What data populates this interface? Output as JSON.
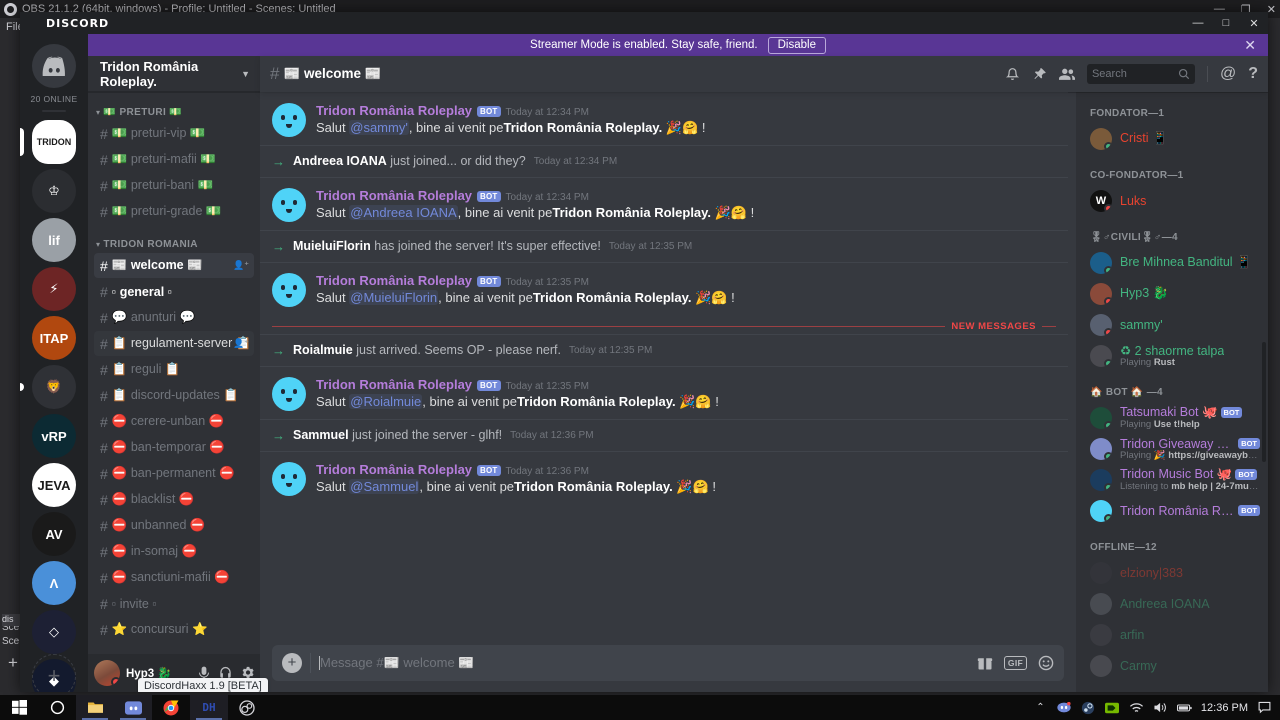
{
  "obs": {
    "title": "OBS 21.1.2 (64bit, windows) - Profile: Untitled - Scenes: Untitled",
    "menu": [
      "File"
    ],
    "side_labels": [
      "Sce",
      "Sce"
    ],
    "scene_item": "dis",
    "add_label": "+",
    "minimize": "—",
    "maximize": "❐",
    "close": "✕"
  },
  "discord": {
    "wordmark": "DISCORD",
    "window_buttons": {
      "minimize": "—",
      "maximize": "□",
      "close": "✕"
    },
    "streamer_banner": {
      "text": "Streamer Mode is enabled. Stay safe, friend.",
      "disable_label": "Disable",
      "close_icon": "✕",
      "color": "#593695"
    },
    "guild_rail": {
      "online_count": "20 ONLINE",
      "home_icon": "discord-home-icon",
      "add_label": "+",
      "servers": [
        {
          "name": "TRIDON RP",
          "short": "TRIDON",
          "selected": true,
          "color": "#ffffff"
        },
        {
          "name": "Crown Server",
          "short": "♔",
          "selected": false,
          "color": "#2b2d31"
        },
        {
          "name": "Elif Server",
          "short": "lif",
          "selected": false,
          "color": "#9aa0a6"
        },
        {
          "name": "Zeus Server",
          "short": "⚡",
          "selected": false,
          "color": "#6d2525"
        },
        {
          "name": "ITAP Server",
          "short": "ITAP",
          "selected": false,
          "color": "#b1480f"
        },
        {
          "name": "Lion Server",
          "short": "🦁",
          "selected": false,
          "color": "#2f3136"
        },
        {
          "name": "VRP Server",
          "short": "vRP",
          "selected": false,
          "color": "#0c2a33"
        },
        {
          "name": "JEVA Server",
          "short": "JEVA",
          "selected": false,
          "color": "#ffffff"
        },
        {
          "name": "AV Server",
          "short": "AV",
          "selected": false,
          "color": "#1a1a1a"
        },
        {
          "name": "A Server",
          "short": "Λ",
          "selected": false,
          "color": "#4a90d9"
        },
        {
          "name": "Crest Server",
          "short": "◇",
          "selected": false,
          "color": "#1d2034"
        },
        {
          "name": "Blue Diamond Server",
          "short": "◆",
          "selected": false,
          "color": "#131a2e"
        }
      ]
    },
    "sidebar": {
      "guild_name": "Tridon România Roleplay.",
      "chevron_icon": "chevron-down-icon",
      "categories": [
        {
          "label": "💵 PRETURI 💵",
          "channels": [
            {
              "name": "💵 preturi-vip 💵",
              "state": "muted"
            },
            {
              "name": "💵 preturi-mafii 💵",
              "state": "muted"
            },
            {
              "name": "💵 preturi-bani 💵",
              "state": "muted"
            },
            {
              "name": "💵 preturi-grade 💵",
              "state": "muted"
            }
          ]
        },
        {
          "label": "TRIDON ROMANIA",
          "channels": [
            {
              "name": "📰 welcome 📰",
              "state": "active",
              "invite": true
            },
            {
              "name": "▫ general ▫",
              "state": "unread"
            },
            {
              "name": "💬 anunturi 💬",
              "state": "muted"
            },
            {
              "name": "📋 regulament-server 📋",
              "state": "hovered",
              "invite": true
            },
            {
              "name": "📋 reguli 📋",
              "state": "muted"
            },
            {
              "name": "📋 discord-updates 📋",
              "state": "muted"
            },
            {
              "name": "⛔ cerere-unban ⛔",
              "state": "muted"
            },
            {
              "name": "⛔ ban-temporar ⛔",
              "state": "muted"
            },
            {
              "name": "⛔ ban-permanent ⛔",
              "state": "muted"
            },
            {
              "name": "⛔ blacklist ⛔",
              "state": "muted"
            },
            {
              "name": "⛔ unbanned ⛔",
              "state": "muted"
            },
            {
              "name": "⛔ in-somaj ⛔",
              "state": "muted"
            },
            {
              "name": "⛔ sanctiuni-mafii ⛔",
              "state": "muted"
            },
            {
              "name": "▫ invite ▫",
              "state": "muted"
            },
            {
              "name": "⭐ concursuri ⭐",
              "state": "muted"
            }
          ]
        }
      ]
    },
    "user_panel": {
      "name": "Hyp3 🐉",
      "status": "dnd",
      "mic_icon": "microphone-icon",
      "headset_icon": "headset-icon",
      "settings_icon": "gear-icon",
      "tooltip": "DiscordHaxx 1.9 [BETA]"
    },
    "chat_header": {
      "hash": "#",
      "channel_name": "📰 welcome 📰",
      "icons": [
        "bell-icon",
        "pin-icon",
        "members-icon",
        "mention-icon",
        "help-icon"
      ]
    },
    "search": {
      "placeholder": "Search",
      "value": "",
      "icon": "search-icon"
    },
    "messages": [
      {
        "type": "bot",
        "author": "Tridon România Roleplay",
        "bot_tag": "BOT",
        "timestamp": "Today at 12:34 PM",
        "greeting": "Salut ",
        "mention": "@sammy'",
        "middle": ", bine ai venit pe",
        "server": "Tridon România Roleplay.",
        "emoji": "🎉🤗",
        "tail": "!"
      },
      {
        "type": "system",
        "user": "Andreea IOANA",
        "text": "just joined... or did they?",
        "timestamp": "Today at 12:34 PM"
      },
      {
        "type": "bot",
        "author": "Tridon România Roleplay",
        "bot_tag": "BOT",
        "timestamp": "Today at 12:34 PM",
        "greeting": "Salut ",
        "mention": "@Andreea IOANA",
        "middle": ", bine ai venit pe",
        "server": "Tridon România Roleplay.",
        "emoji": "🎉🤗",
        "tail": "!"
      },
      {
        "type": "system",
        "user": "MuieluiFlorin",
        "text": "has joined the server! It's super effective!",
        "timestamp": "Today at 12:35 PM"
      },
      {
        "type": "bot",
        "author": "Tridon România Roleplay",
        "bot_tag": "BOT",
        "timestamp": "Today at 12:35 PM",
        "greeting": "Salut ",
        "mention": "@MuieluiFlorin",
        "middle": ", bine ai venit pe",
        "server": "Tridon România Roleplay.",
        "emoji": "🎉🤗",
        "tail": "!"
      },
      {
        "type": "divider",
        "label": "NEW MESSAGES"
      },
      {
        "type": "system",
        "user": "Roialmuie",
        "text": "just arrived. Seems OP - please nerf.",
        "timestamp": "Today at 12:35 PM"
      },
      {
        "type": "bot",
        "author": "Tridon România Roleplay",
        "bot_tag": "BOT",
        "timestamp": "Today at 12:35 PM",
        "greeting": "Salut ",
        "mention": "@Roialmuie",
        "middle": ", bine ai venit pe",
        "server": "Tridon România Roleplay.",
        "emoji": "🎉🤗",
        "tail": "!"
      },
      {
        "type": "system",
        "user": "Sammuel",
        "text": "just joined the server - glhf!",
        "timestamp": "Today at 12:36 PM"
      },
      {
        "type": "bot",
        "author": "Tridon România Roleplay",
        "bot_tag": "BOT",
        "timestamp": "Today at 12:36 PM",
        "greeting": "Salut ",
        "mention": "@Sammuel",
        "middle": ", bine ai venit pe",
        "server": "Tridon România Roleplay.",
        "emoji": "🎉🤗",
        "tail": "!"
      }
    ],
    "input": {
      "placeholder": "Message #📰 welcome 📰",
      "value": "",
      "plus_icon": "plus-icon",
      "gift_icon": "gift-icon",
      "gif_label": "GIF",
      "emoji_icon": "emoji-icon"
    },
    "members": [
      {
        "group": "FONDATOR—1",
        "users": [
          {
            "name": "Cristi",
            "suffix": "📱",
            "color": "#e8432f",
            "status": "online",
            "avatar": "#7a5a3a"
          }
        ]
      },
      {
        "group": "CO-FONDATOR—1",
        "users": [
          {
            "name": "Luks",
            "suffix": "",
            "color": "#e8432f",
            "status": "dnd",
            "avatar": "#111111",
            "initial": "W"
          }
        ]
      },
      {
        "group": "🎖♂CIVILI🎖♂—4",
        "users": [
          {
            "name": "Bre Mihnea Banditul",
            "suffix": "📱",
            "color": "#43b581",
            "status": "online",
            "avatar": "#1b5e8a"
          },
          {
            "name": "Hyp3 🐉",
            "suffix": "",
            "color": "#43b581",
            "status": "dnd",
            "avatar": "#8a4a3a"
          },
          {
            "name": "sammy'",
            "suffix": "",
            "color": "#43b581",
            "status": "dnd",
            "avatar": "#586070"
          },
          {
            "name": "♻ 2 shaorme talpa",
            "suffix": "",
            "color": "#43b581",
            "status": "online",
            "avatar": "#4a4a50",
            "activity_prefix": "Playing ",
            "activity": "Rust"
          }
        ]
      },
      {
        "group": "🏠 BOT 🏠 —4",
        "users": [
          {
            "name": "Tatsumaki Bot 🐙",
            "bot": "BOT",
            "color": "#b57ddb",
            "status": "online",
            "avatar": "#1e4d3a",
            "activity_prefix": "Playing ",
            "activity": "Use t!help"
          },
          {
            "name": "Tridon Giveaway B...",
            "bot": "BOT",
            "color": "#b57ddb",
            "status": "online",
            "avatar": "#7f8cc9",
            "activity_prefix": "Playing 🎉 ",
            "activity": "https://giveawaybot.p..."
          },
          {
            "name": "Tridon Music Bot 🐙",
            "bot": "BOT",
            "color": "#b57ddb",
            "status": "online",
            "avatar": "#1b3c5e",
            "activity_prefix": "Listening to ",
            "activity": "mb help | 24-7music.c..."
          },
          {
            "name": "Tridon România Ro...",
            "bot": "BOT",
            "color": "#b57ddb",
            "status": "online",
            "avatar": "#4fd3f7"
          }
        ]
      },
      {
        "group": "OFFLINE—12",
        "users": [
          {
            "name": "elziony|383",
            "color": "#e8432f",
            "status": "offline",
            "avatar": "#3a3a40"
          },
          {
            "name": "Andreea IOANA",
            "color": "#43b581",
            "status": "offline",
            "avatar": "#6b6f78"
          },
          {
            "name": "arfin",
            "color": "#43b581",
            "status": "offline",
            "avatar": "#4a4a52"
          },
          {
            "name": "Carmy",
            "color": "#43b581",
            "status": "offline",
            "avatar": "#6b6b72"
          }
        ]
      }
    ]
  },
  "taskbar": {
    "items": [
      "start-icon",
      "cortana-icon",
      "explorer-icon",
      "discord-icon",
      "chrome-icon",
      "dh-icon",
      "obs-icon"
    ],
    "tray": [
      "chevron-up-icon",
      "discord-tray-icon",
      "steam-tray-icon",
      "nvidia-tray-icon",
      "wifi-icon",
      "volume-icon",
      "battery-icon"
    ],
    "clock": "12:36 PM",
    "notification_icon": "notification-icon"
  }
}
